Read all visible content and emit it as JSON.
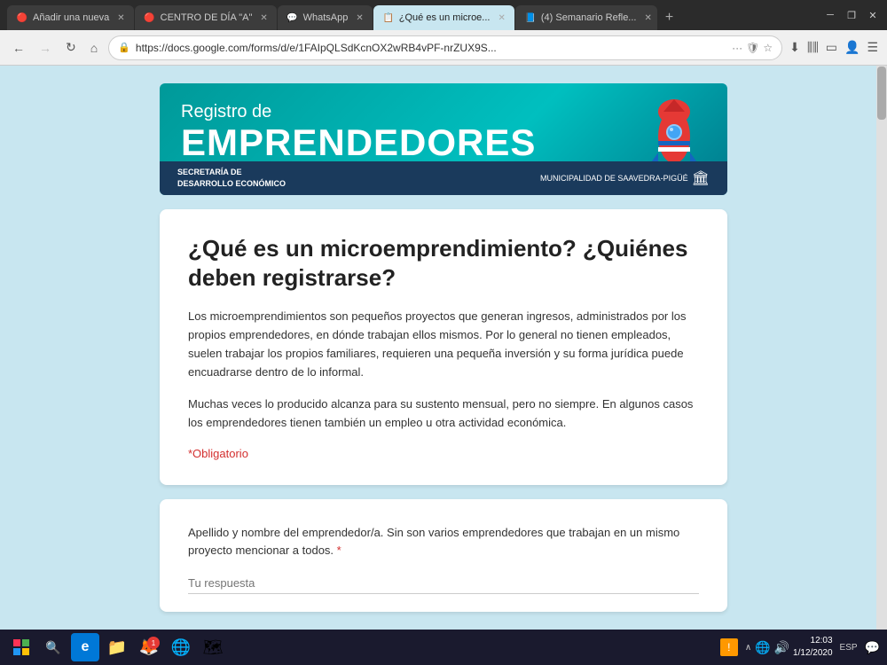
{
  "browser": {
    "tabs": [
      {
        "id": "tab1",
        "label": "Añadir una nueva",
        "icon": "🔴",
        "active": false,
        "favicon_color": "#cc0000"
      },
      {
        "id": "tab2",
        "label": "CENTRO DE DÍA \"A\"",
        "icon": "🔴",
        "active": false,
        "favicon_color": "#cc0000"
      },
      {
        "id": "tab3",
        "label": "WhatsApp",
        "icon": "💬",
        "active": false,
        "favicon_color": "#25d366"
      },
      {
        "id": "tab4",
        "label": "¿Qué es un microe...",
        "icon": "📋",
        "active": true,
        "favicon_color": "#6c63ff"
      },
      {
        "id": "tab5",
        "label": "(4) Semanario Refle...",
        "icon": "📘",
        "active": false,
        "favicon_color": "#1877f2"
      }
    ],
    "url": "https://docs.google.com/forms/d/e/1FAIpQLSdKcnOX2wRB4vPF-nrZUX9S...",
    "nav": {
      "back_disabled": false,
      "forward_disabled": true
    }
  },
  "banner": {
    "title_small": "Registro de",
    "title_large": "EMPRENDEDORES",
    "footer_left_line1": "SECRETARÍA DE",
    "footer_left_line2": "DESARROLLO ECONÓMICO",
    "footer_right": "MUNICIPALIDAD DE SAAVEDRA-PIGÜÉ"
  },
  "info_card": {
    "title": "¿Qué es un microemprendimiento? ¿Quiénes deben registrarse?",
    "body1": "Los microemprendimientos son pequeños proyectos que generan ingresos, administrados por los propios emprendedores, en dónde trabajan ellos mismos. Por lo general no tienen empleados,  suelen trabajar los propios familiares, requieren una pequeña inversión y su forma jurídica puede encuadrarse dentro de lo informal.",
    "body2": "Muchas veces lo  producido alcanza para su sustento mensual, pero no siempre. En algunos casos los emprendedores tienen también un empleo u otra actividad económica.",
    "obligatorio": "*Obligatorio"
  },
  "form_card": {
    "label": "Apellido y nombre del emprendedor/a. Sin son varios emprendedores que trabajan en un mismo proyecto mencionar a todos.",
    "required_marker": "*",
    "placeholder": "Tu respuesta"
  },
  "taskbar": {
    "clock_time": "12:03",
    "clock_date": "1/12/2020",
    "lang": "ESP",
    "notification_count": "1"
  }
}
